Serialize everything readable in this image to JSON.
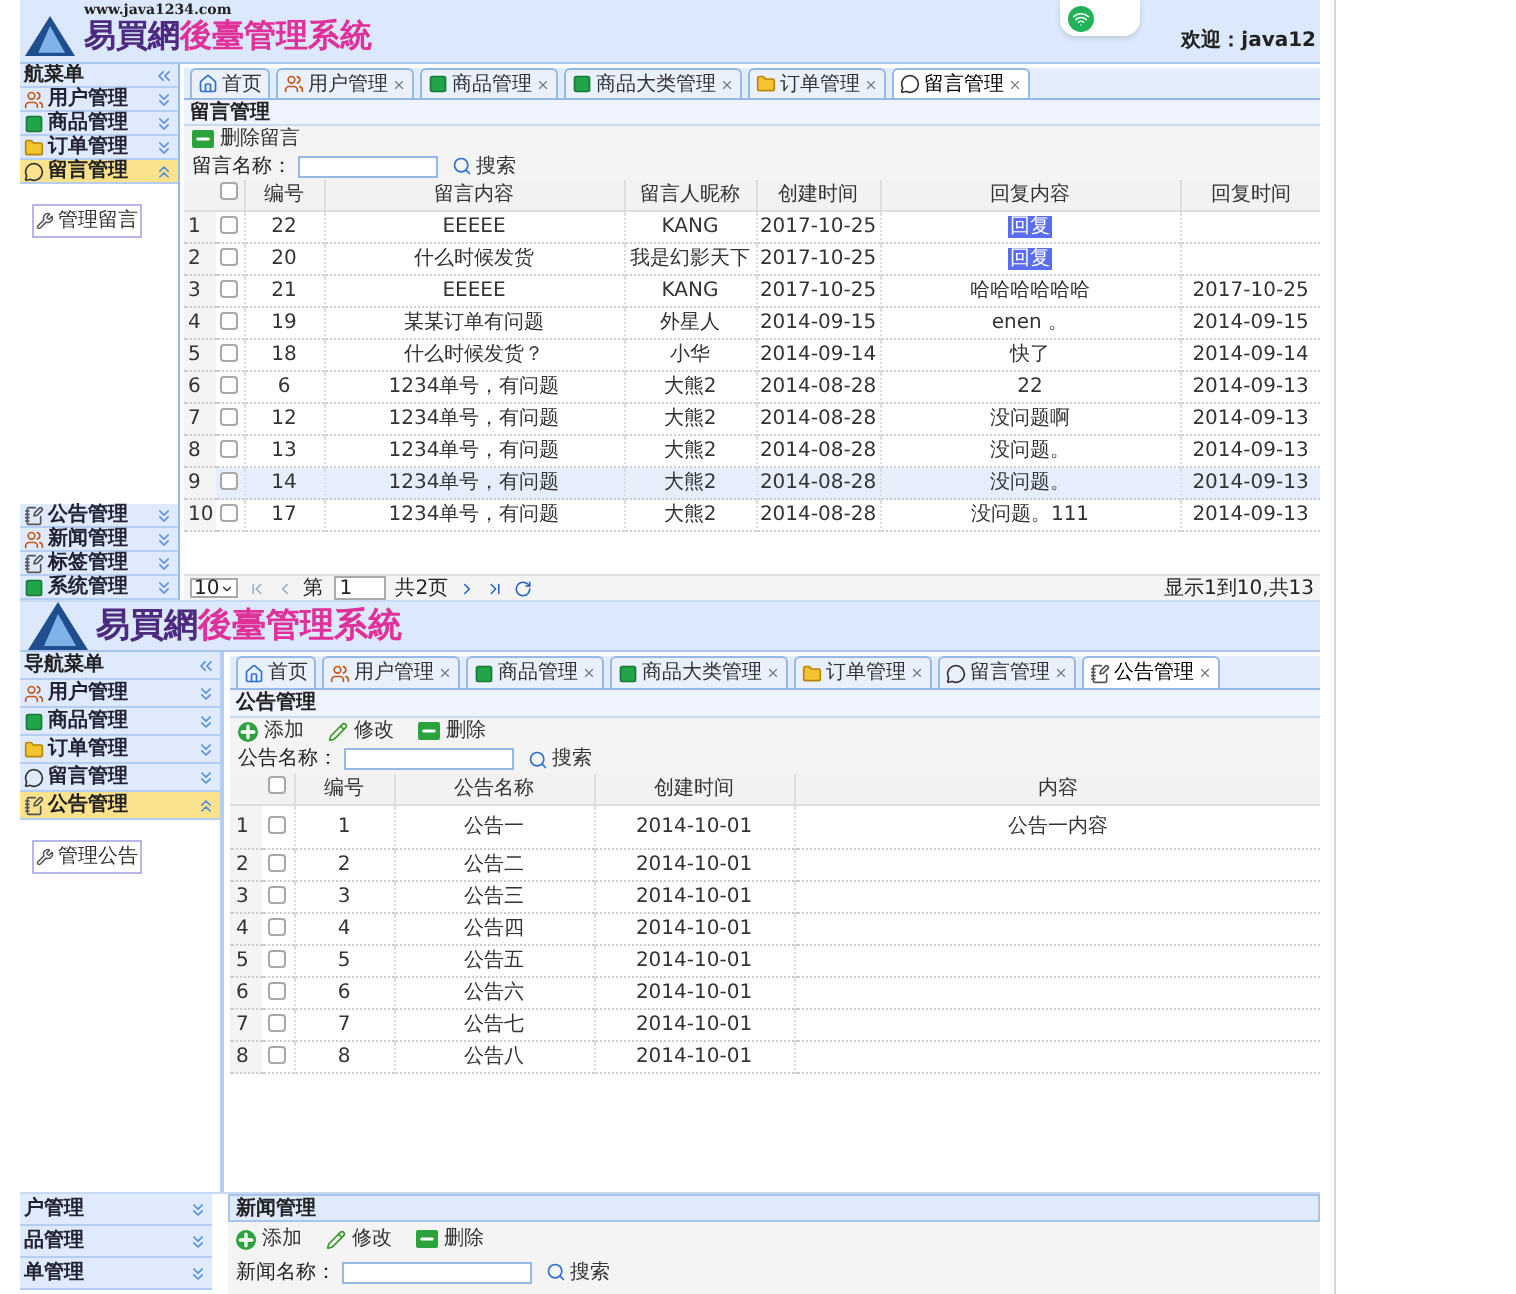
{
  "message_screen": {
    "header": {
      "url": "www.java1234.com",
      "logo_name": "易買網",
      "logo_suffix": "後臺管理系統",
      "welcome": "欢迎：java12"
    },
    "sidebar": {
      "title": "航菜单",
      "items": [
        {
          "label": "用户管理",
          "selected": false
        },
        {
          "label": "商品管理",
          "selected": false
        },
        {
          "label": "订单管理",
          "selected": false
        },
        {
          "label": "留言管理",
          "selected": true,
          "children": [
            {
              "label": "管理留言"
            }
          ]
        }
      ],
      "bottom_items": [
        {
          "label": "公告管理",
          "selected": false
        },
        {
          "label": "新闻管理",
          "selected": false
        },
        {
          "label": "标签管理",
          "selected": false
        },
        {
          "label": "系统管理",
          "selected": false
        }
      ]
    },
    "tabs": [
      {
        "label": "首页",
        "selected": false,
        "closable": false
      },
      {
        "label": "用户管理",
        "selected": false,
        "closable": true
      },
      {
        "label": "商品管理",
        "selected": false,
        "closable": true
      },
      {
        "label": "商品大类管理",
        "selected": false,
        "closable": true
      },
      {
        "label": "订单管理",
        "selected": false,
        "closable": true
      },
      {
        "label": "留言管理",
        "selected": true,
        "closable": true
      }
    ],
    "panel_title": "留言管理",
    "toolbar": [
      {
        "label": "删除留言",
        "kind": "delete"
      }
    ],
    "search": {
      "label": "留言名称：",
      "button": "搜索"
    },
    "table": {
      "all_checked": false,
      "columns": [
        "编号",
        "留言内容",
        "留言人昵称",
        "创建时间",
        "回复内容",
        "回复时间"
      ],
      "rows": [
        {
          "num": "1",
          "checked": false,
          "highlighted": false,
          "cells": [
            "22",
            "EEEEE",
            "KANG",
            "2017-10-25"
          ],
          "reply": {
            "text": "回复",
            "kind": "link"
          }
        },
        {
          "num": "2",
          "checked": false,
          "highlighted": false,
          "cells": [
            "20",
            "什么时候发货",
            "我是幻影天下",
            "2017-10-25"
          ],
          "reply": {
            "text": "回复",
            "kind": "link"
          }
        },
        {
          "num": "3",
          "checked": false,
          "highlighted": false,
          "cells": [
            "21",
            "EEEEE",
            "KANG",
            "2017-10-25"
          ],
          "reply": {
            "text": "哈哈哈哈哈哈",
            "kind": "text"
          },
          "reply_time": "2017-10-25"
        },
        {
          "num": "4",
          "checked": false,
          "highlighted": false,
          "cells": [
            "19",
            "某某订单有问题",
            "外星人",
            "2014-09-15"
          ],
          "reply": {
            "text": "enen 。",
            "kind": "text"
          },
          "reply_time": "2014-09-15"
        },
        {
          "num": "5",
          "checked": false,
          "highlighted": false,
          "cells": [
            "18",
            "什么时候发货？",
            "小华",
            "2014-09-14"
          ],
          "reply": {
            "text": "快了",
            "kind": "text"
          },
          "reply_time": "2014-09-14"
        },
        {
          "num": "6",
          "checked": false,
          "highlighted": false,
          "cells": [
            "6",
            "1234单号，有问题",
            "大熊2",
            "2014-08-28"
          ],
          "reply": {
            "text": "22",
            "kind": "text"
          },
          "reply_time": "2014-09-13"
        },
        {
          "num": "7",
          "checked": false,
          "highlighted": false,
          "cells": [
            "12",
            "1234单号，有问题",
            "大熊2",
            "2014-08-28"
          ],
          "reply": {
            "text": "没问题啊",
            "kind": "text"
          },
          "reply_time": "2014-09-13"
        },
        {
          "num": "8",
          "checked": false,
          "highlighted": false,
          "cells": [
            "13",
            "1234单号，有问题",
            "大熊2",
            "2014-08-28"
          ],
          "reply": {
            "text": "没问题。",
            "kind": "text"
          },
          "reply_time": "2014-09-13"
        },
        {
          "num": "9",
          "checked": false,
          "highlighted": true,
          "cells": [
            "14",
            "1234单号，有问题",
            "大熊2",
            "2014-08-28"
          ],
          "reply": {
            "text": "没问题。",
            "kind": "text"
          },
          "reply_time": "2014-09-13"
        },
        {
          "num": "10",
          "checked": false,
          "highlighted": false,
          "cells": [
            "17",
            "1234单号，有问题",
            "大熊2",
            "2014-08-28"
          ],
          "reply": {
            "text": "没问题。111",
            "kind": "text"
          },
          "reply_time": "2014-09-13"
        }
      ]
    },
    "pager": {
      "page_size": "10",
      "page_label": "第",
      "page": "1",
      "total_pages": "共2页",
      "summary": "显示1到10,共13"
    }
  },
  "notice_screen": {
    "header": {
      "logo_name": "易買網",
      "logo_suffix": "後臺管理系統"
    },
    "sidebar": {
      "title": "导航菜单",
      "items": [
        {
          "label": "用户管理",
          "selected": false
        },
        {
          "label": "商品管理",
          "selected": false
        },
        {
          "label": "订单管理",
          "selected": false
        },
        {
          "label": "留言管理",
          "selected": false
        },
        {
          "label": "公告管理",
          "selected": true,
          "children": [
            {
              "label": "管理公告"
            }
          ]
        }
      ]
    },
    "tabs": [
      {
        "label": "首页",
        "selected": false,
        "closable": false
      },
      {
        "label": "用户管理",
        "selected": false,
        "closable": true
      },
      {
        "label": "商品管理",
        "selected": false,
        "closable": true
      },
      {
        "label": "商品大类管理",
        "selected": false,
        "closable": true
      },
      {
        "label": "订单管理",
        "selected": false,
        "closable": true
      },
      {
        "label": "留言管理",
        "selected": false,
        "closable": true
      },
      {
        "label": "公告管理",
        "selected": true,
        "closable": true
      }
    ],
    "panel_title": "公告管理",
    "toolbar": [
      {
        "label": "添加",
        "kind": "add"
      },
      {
        "label": "修改",
        "kind": "edit"
      },
      {
        "label": "删除",
        "kind": "delete"
      }
    ],
    "search": {
      "label": "公告名称：",
      "button": "搜索"
    },
    "table": {
      "all_checked": false,
      "columns": [
        "编号",
        "公告名称",
        "创建时间",
        "内容"
      ],
      "rows": [
        {
          "num": "1",
          "checked": false,
          "cells": [
            "1",
            "公告一",
            "2014-10-01",
            "公告一内容"
          ]
        },
        {
          "num": "2",
          "checked": false,
          "cells": [
            "2",
            "公告二",
            "2014-10-01"
          ]
        },
        {
          "num": "3",
          "checked": false,
          "cells": [
            "3",
            "公告三",
            "2014-10-01"
          ]
        },
        {
          "num": "4",
          "checked": false,
          "cells": [
            "4",
            "公告四",
            "2014-10-01"
          ]
        },
        {
          "num": "5",
          "checked": false,
          "cells": [
            "5",
            "公告五",
            "2014-10-01"
          ]
        },
        {
          "num": "6",
          "checked": false,
          "cells": [
            "6",
            "公告六",
            "2014-10-01"
          ]
        },
        {
          "num": "7",
          "checked": false,
          "cells": [
            "7",
            "公告七",
            "2014-10-01"
          ]
        },
        {
          "num": "8",
          "checked": false,
          "cells": [
            "8",
            "公告八",
            "2014-10-01"
          ]
        }
      ]
    }
  },
  "news_screen": {
    "sidebar": {
      "items": [
        {
          "label": "户管理",
          "selected": false
        },
        {
          "label": "品管理",
          "selected": false
        },
        {
          "label": "单管理",
          "selected": false
        }
      ]
    },
    "panel_title": "新闻管理",
    "toolbar": [
      {
        "label": "添加",
        "kind": "add"
      },
      {
        "label": "修改",
        "kind": "edit"
      },
      {
        "label": "删除",
        "kind": "delete"
      }
    ],
    "search": {
      "label": "新闻名称：",
      "button": "搜索"
    }
  }
}
